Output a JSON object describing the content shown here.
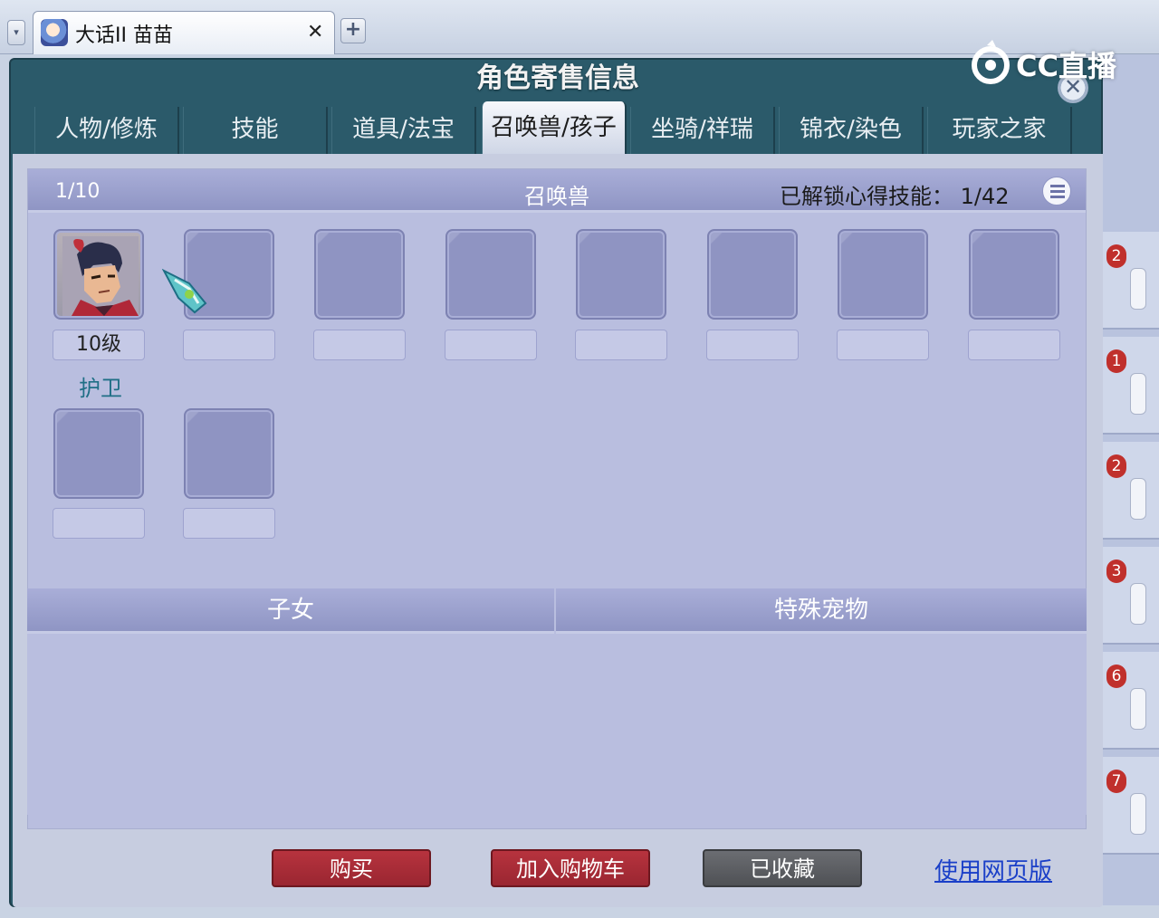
{
  "browser": {
    "tab_title": "大话II 苗苗",
    "close_glyph": "✕",
    "new_tab_glyph": "+",
    "dropdown_glyph": "▾"
  },
  "watermark": {
    "text": "CC直播"
  },
  "dialog": {
    "title": "角色寄售信息",
    "close_glyph": "✕",
    "tabs": [
      {
        "label": "人物/修炼",
        "active": false
      },
      {
        "label": "技能",
        "active": false
      },
      {
        "label": "道具/法宝",
        "active": false
      },
      {
        "label": "召唤兽/孩子",
        "active": true
      },
      {
        "label": "坐骑/祥瑞",
        "active": false
      },
      {
        "label": "锦衣/染色",
        "active": false
      },
      {
        "label": "玩家之家",
        "active": false
      }
    ]
  },
  "pets_panel": {
    "count": "1/10",
    "title": "召唤兽",
    "unlock_text": "已解锁心得技能：",
    "unlock_count": "1/42",
    "first_pet": {
      "level": "10级",
      "name": "护卫"
    }
  },
  "children_panel": {
    "title": "子女"
  },
  "special_panel": {
    "title": "特殊宠物"
  },
  "actions": {
    "buy": "购买",
    "add_to_cart": "加入购物车",
    "favorited": "已收藏",
    "web_version": "使用网页版"
  },
  "background_badges": [
    "2",
    "1",
    "2",
    "3",
    "6",
    "7"
  ],
  "colors": {
    "dialog_frame": "#2b5a6a",
    "panel_bg": "#b9bedf",
    "header_bg": "#9a9fcd",
    "pet_name": "#1f6f86",
    "button_red": "#a92c37",
    "button_gray": "#5c5e63",
    "link": "#1a3fc8"
  }
}
